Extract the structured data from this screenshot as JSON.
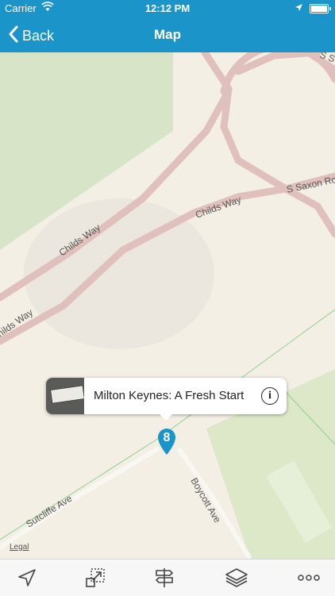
{
  "status_bar": {
    "carrier": "Carrier",
    "time": "12:12 PM",
    "icons": [
      "wifi-icon",
      "location-arrow-icon",
      "battery-icon"
    ]
  },
  "nav_bar": {
    "back_label": "Back",
    "title": "Map",
    "background_color": "#1a94c9"
  },
  "map": {
    "street_labels": [
      "Childs Way",
      "Childs Way",
      "hilds Way",
      "S Saxon Ro",
      "S S",
      "Boycott Ave",
      "Sutcliffe Ave"
    ],
    "legal_label": "Legal"
  },
  "callout": {
    "title": "Milton Keynes: A Fresh Start",
    "thumbnail": "street-sign-photo",
    "info_icon": "info-icon"
  },
  "pin": {
    "number": "8",
    "color": "#1a94c9"
  },
  "toolbar": {
    "items": [
      "location-arrow-icon",
      "resize-icon",
      "signpost-icon",
      "layers-icon",
      "more-icon"
    ]
  }
}
